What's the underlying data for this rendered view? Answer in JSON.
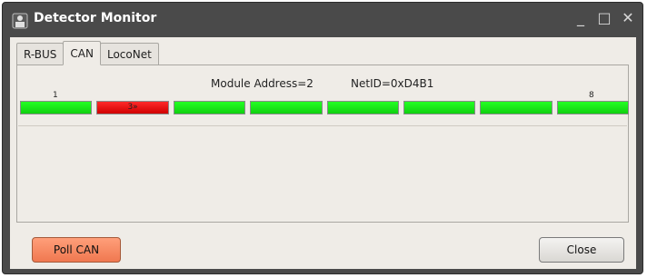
{
  "window": {
    "title": "Detector Monitor",
    "controls": {
      "minimize": "_",
      "maximize": "□",
      "close": "✕"
    }
  },
  "tabs": [
    {
      "label": "R-BUS",
      "active": false
    },
    {
      "label": "CAN",
      "active": true
    },
    {
      "label": "LocoNet",
      "active": false
    }
  ],
  "module": {
    "address_text": "Module Address=2",
    "netid_text": "NetID=0xD4B1",
    "first_label": "1",
    "last_label": "8"
  },
  "detectors": [
    {
      "text": "",
      "state": "free"
    },
    {
      "text": "3»",
      "state": "occupied"
    },
    {
      "text": "",
      "state": "free"
    },
    {
      "text": "",
      "state": "free"
    },
    {
      "text": "",
      "state": "free"
    },
    {
      "text": "",
      "state": "free"
    },
    {
      "text": "",
      "state": "free"
    },
    {
      "text": "",
      "state": "free"
    }
  ],
  "buttons": {
    "poll_label": "Poll CAN",
    "close_label": "Close"
  },
  "colors": {
    "free": "#1ee61e",
    "occupied": "#ee1111",
    "poll_button": "#f58a62",
    "titlebar": "#4a4a4a"
  }
}
